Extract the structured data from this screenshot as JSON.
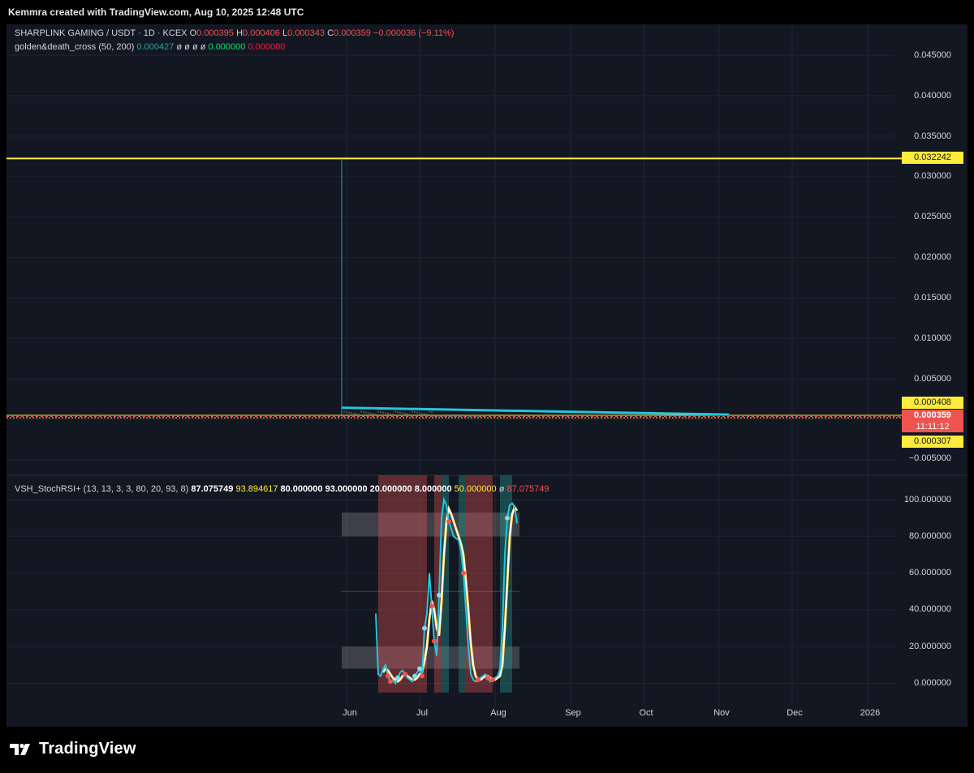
{
  "header": {
    "title": "Kemmra created with TradingView.com, Aug 10, 2025 12:48 UTC"
  },
  "legend": {
    "symbol": "SHARPLINK GAMING / USDT · 1D · KCEX",
    "o_label": "O",
    "o_val": "0.000395",
    "h_label": "H",
    "h_val": "0.000406",
    "l_label": "L",
    "l_val": "0.000343",
    "c_label": "C",
    "c_val": "0.000359",
    "change": "−0.000036 (−9.11%)"
  },
  "indicator": {
    "name": "golden&death_cross (50, 200)",
    "v1": "0.000427",
    "phi": "ø ø ø ø",
    "v2": "0.000000",
    "v3": "0.000000"
  },
  "stoch_legend": {
    "name": "VSH_StochRSI+ (13, 13, 3, 3, 80, 20, 93, 8)",
    "k": "87.075749",
    "d": "93.894617",
    "l80": "80.000000",
    "l93": "93.000000",
    "l20": "20.000000",
    "l8": "8.000000",
    "l50": "50.000000",
    "phi": "ø",
    "last": "87.075749"
  },
  "price_axis": {
    "ticks": [
      "0.045000",
      "0.040000",
      "0.035000",
      "0.030000",
      "0.025000",
      "0.020000",
      "0.015000",
      "0.010000",
      "0.005000",
      "0.000000",
      "−0.005000"
    ]
  },
  "price_boxes": {
    "hline": "0.032242",
    "upper": "0.000408",
    "last": "0.000359",
    "countdown": "11:11:12",
    "lower": "0.000307"
  },
  "stoch_axis": {
    "ticks": [
      "100.000000",
      "80.000000",
      "60.000000",
      "40.000000",
      "20.000000",
      "0.000000"
    ]
  },
  "time_axis": {
    "labels": [
      "Jun",
      "Jul",
      "Aug",
      "Sep",
      "Oct",
      "Nov",
      "Dec",
      "2026"
    ]
  },
  "footer": {
    "brand": "TradingView"
  },
  "colors": {
    "bg": "#131722",
    "hline": "#ffeb3b",
    "trend": "#26c6da",
    "k_line": "#26c6da",
    "d_line": "#ffffff",
    "band_red": "#ef5350",
    "band_green": "#26a69a"
  },
  "chart_data": [
    {
      "type": "line",
      "title": "SHARPLINK GAMING / USDT · 1D · KCEX",
      "ylim": [
        -0.0075,
        0.0485
      ],
      "yticks": [
        0.045,
        0.04,
        0.035,
        0.03,
        0.025,
        0.02,
        0.015,
        0.01,
        0.005,
        0,
        -0.005
      ],
      "grid": true,
      "horizontal_lines": [
        0.032242,
        0.000408,
        0.000307
      ],
      "last_price": 0.000359,
      "ohlc_last": {
        "open": 0.000395,
        "high": 0.000406,
        "low": 0.000343,
        "close": 0.000359
      },
      "spike": {
        "date": "2025-05-30",
        "high": 0.032242
      },
      "trendline": {
        "from": [
          "2025-05-30",
          0.00145
        ],
        "to": [
          "2025-11-05",
          0.0006
        ]
      }
    },
    {
      "type": "line",
      "title": "VSH_StochRSI+ (13, 13, 3, 3, 80, 20, 93, 8)",
      "ylim": [
        -5,
        105
      ],
      "yticks": [
        100,
        80,
        60,
        40,
        20,
        0
      ],
      "grid": true,
      "bands": [
        {
          "from": 80,
          "to": 93
        },
        {
          "from": 8,
          "to": 20
        }
      ],
      "shaded_ranges": [
        {
          "color": "red",
          "from": "2025-06-14",
          "to": "2025-06-25"
        },
        {
          "color": "red",
          "from": "2025-06-25",
          "to": "2025-07-04"
        },
        {
          "color": "red",
          "from": "2025-07-07",
          "to": "2025-07-10"
        },
        {
          "color": "green",
          "from": "2025-07-10",
          "to": "2025-07-13"
        },
        {
          "color": "green",
          "from": "2025-07-17",
          "to": "2025-07-20"
        },
        {
          "color": "red",
          "from": "2025-07-20",
          "to": "2025-07-31"
        },
        {
          "color": "green",
          "from": "2025-08-03",
          "to": "2025-08-08"
        }
      ],
      "x": [
        "2025-06-13",
        "2025-06-14",
        "2025-06-15",
        "2025-06-16",
        "2025-06-17",
        "2025-06-18",
        "2025-06-19",
        "2025-06-20",
        "2025-06-21",
        "2025-06-22",
        "2025-06-23",
        "2025-06-24",
        "2025-06-25",
        "2025-06-26",
        "2025-06-27",
        "2025-06-28",
        "2025-06-29",
        "2025-06-30",
        "2025-07-01",
        "2025-07-02",
        "2025-07-03",
        "2025-07-04",
        "2025-07-05",
        "2025-07-06",
        "2025-07-07",
        "2025-07-08",
        "2025-07-09",
        "2025-07-10",
        "2025-07-11",
        "2025-07-12",
        "2025-07-13",
        "2025-07-14",
        "2025-07-15",
        "2025-07-16",
        "2025-07-17",
        "2025-07-18",
        "2025-07-19",
        "2025-07-20",
        "2025-07-21",
        "2025-07-22",
        "2025-07-23",
        "2025-07-24",
        "2025-07-25",
        "2025-07-26",
        "2025-07-27",
        "2025-07-28",
        "2025-07-29",
        "2025-07-30",
        "2025-07-31",
        "2025-08-01",
        "2025-08-02",
        "2025-08-03",
        "2025-08-04",
        "2025-08-05",
        "2025-08-06",
        "2025-08-07",
        "2025-08-08",
        "2025-08-09",
        "2025-08-10"
      ],
      "series": [
        {
          "name": "K",
          "values": [
            38,
            5,
            4,
            8,
            10,
            4,
            1,
            2,
            0,
            3,
            6,
            7,
            5,
            3,
            2,
            1,
            4,
            6,
            8,
            4,
            30,
            38,
            60,
            42,
            23,
            15,
            48,
            90,
            100,
            97,
            88,
            84,
            80,
            79,
            78,
            72,
            60,
            40,
            20,
            5,
            2,
            1,
            2,
            3,
            4,
            5,
            3,
            1,
            2,
            3,
            4,
            8,
            30,
            70,
            90,
            97,
            98,
            96,
            87
          ]
        },
        {
          "name": "D",
          "values": [
            null,
            null,
            null,
            6,
            8,
            7,
            5,
            3,
            2,
            1,
            2,
            4,
            5,
            4,
            3,
            2,
            2,
            3,
            5,
            6,
            12,
            20,
            35,
            45,
            40,
            30,
            26,
            45,
            70,
            88,
            95,
            92,
            88,
            84,
            80,
            76,
            70,
            56,
            40,
            22,
            10,
            4,
            2,
            2,
            3,
            4,
            4,
            3,
            2,
            2,
            3,
            4,
            10,
            30,
            55,
            80,
            92,
            96,
            94
          ]
        }
      ]
    }
  ]
}
